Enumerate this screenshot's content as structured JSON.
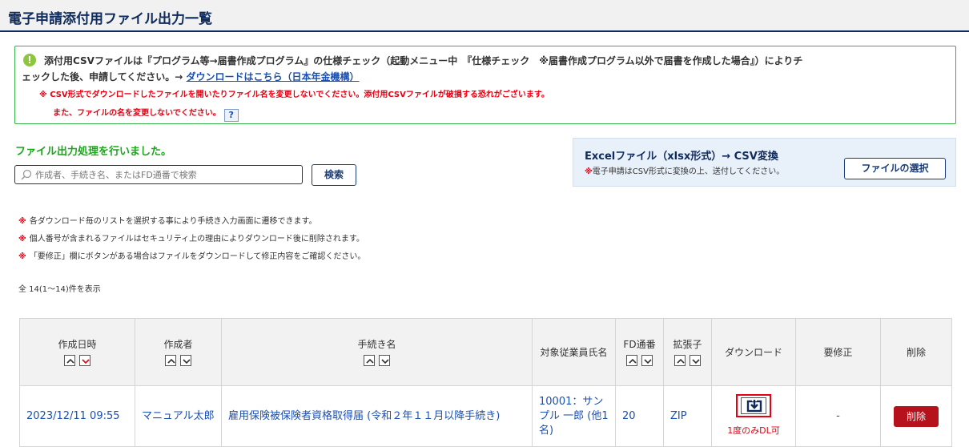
{
  "page": {
    "title": "電子申請添付用ファイル出力一覧"
  },
  "notice": {
    "icon": "exclamation-icon",
    "line1": "添付用CSVファイルは『プログラム等→届書作成プログラム』の仕様チェック（起動メニュー中　『仕様チェック　※届書作成プログラム以外で届書を作成した場合』）によりチ",
    "line2_prefix": "ェックした後、申請してください。→ ",
    "link": "ダウンロードはこちら（日本年金機構）",
    "warn1": "※ CSV形式でダウンロードしたファイルを開いたりファイル名を変更しないでください。添付用CSVファイルが破損する恐れがございます。",
    "warn2": "また、ファイルの名を変更しないでください。",
    "help": "?"
  },
  "result_message": "ファイル出力処理を行いました。",
  "search": {
    "placeholder": "作成者、手続き名、またはFD通番で検索",
    "value": "",
    "button": "検索"
  },
  "excel": {
    "title": "Excelファイル（xlsx形式）→ CSV変換",
    "note_mark": "※",
    "note": "電子申請はCSV形式に変換の上、送付してください。",
    "button": "ファイルの選択"
  },
  "notes": [
    {
      "mark": "※",
      "text": "各ダウンロード毎のリストを選択する事により手続き入力画面に遷移できます。"
    },
    {
      "mark": "※",
      "text": "個人番号が含まれるファイルはセキュリティ上の理由によりダウンロード後に削除されます。"
    },
    {
      "mark": "※",
      "text": "「要修正」欄にボタンがある場合はファイルをダウンロードして修正内容をご確認ください。"
    }
  ],
  "count": "全 14(1〜14)件を表示",
  "table": {
    "headers": {
      "created_at": "作成日時",
      "creator": "作成者",
      "procedure": "手続き名",
      "employee": "対象従業員氏名",
      "fd": "FD通番",
      "ext": "拡張子",
      "download": "ダウンロード",
      "fix": "要修正",
      "delete": "削除"
    },
    "rows": [
      {
        "created_at": "2023/12/11 09:55",
        "creator": "マニュアル太郎",
        "procedure": "雇用保険被保険者資格取得届 (令和２年１１月以降手続き)",
        "employee": "10001：サンプル 一郎 (他1名)",
        "fd": "20",
        "ext": "ZIP",
        "download_note": "1度のみDL可",
        "fix": "-",
        "delete": "削除"
      }
    ]
  },
  "colors": {
    "accent": "#0f2a5c",
    "link": "#1a4fb4",
    "warning": "#e60012",
    "success": "#1aa51a",
    "delete": "#b5121b"
  }
}
